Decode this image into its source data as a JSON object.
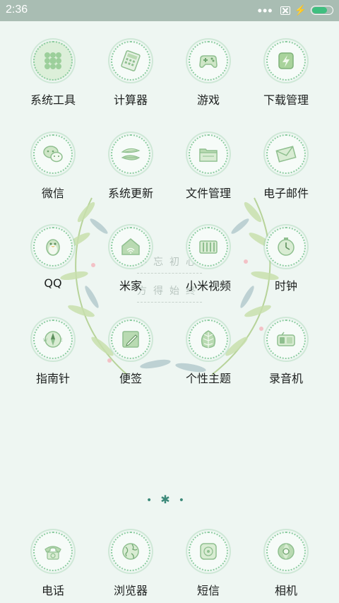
{
  "status_bar": {
    "time": "2:36",
    "battery_level": 0.75,
    "colors": {
      "bar": "#a9bdb3",
      "battery": "#3fbf7f"
    }
  },
  "wallpaper": {
    "text_line1": "不忘初心",
    "text_line2": "方得始终"
  },
  "apps": [
    {
      "label": "系统工具",
      "icon": "folder-tools-icon"
    },
    {
      "label": "计算器",
      "icon": "calculator-icon"
    },
    {
      "label": "游戏",
      "icon": "gamepad-icon"
    },
    {
      "label": "下载管理",
      "icon": "download-manager-icon"
    },
    {
      "label": "微信",
      "icon": "wechat-icon"
    },
    {
      "label": "系统更新",
      "icon": "system-update-icon"
    },
    {
      "label": "文件管理",
      "icon": "folder-icon"
    },
    {
      "label": "电子邮件",
      "icon": "envelope-icon"
    },
    {
      "label": "QQ",
      "icon": "penguin-icon"
    },
    {
      "label": "米家",
      "icon": "home-icon"
    },
    {
      "label": "小米视频",
      "icon": "video-icon"
    },
    {
      "label": "时钟",
      "icon": "clock-icon"
    },
    {
      "label": "指南针",
      "icon": "compass-icon"
    },
    {
      "label": "便签",
      "icon": "notes-icon"
    },
    {
      "label": "个性主题",
      "icon": "theme-leaf-icon"
    },
    {
      "label": "录音机",
      "icon": "recorder-icon"
    }
  ],
  "dock": [
    {
      "label": "电话",
      "icon": "telephone-icon"
    },
    {
      "label": "浏览器",
      "icon": "globe-icon"
    },
    {
      "label": "短信",
      "icon": "message-icon"
    },
    {
      "label": "相机",
      "icon": "camera-icon"
    }
  ],
  "page_indicator": {
    "pages": 3,
    "current": 2
  }
}
